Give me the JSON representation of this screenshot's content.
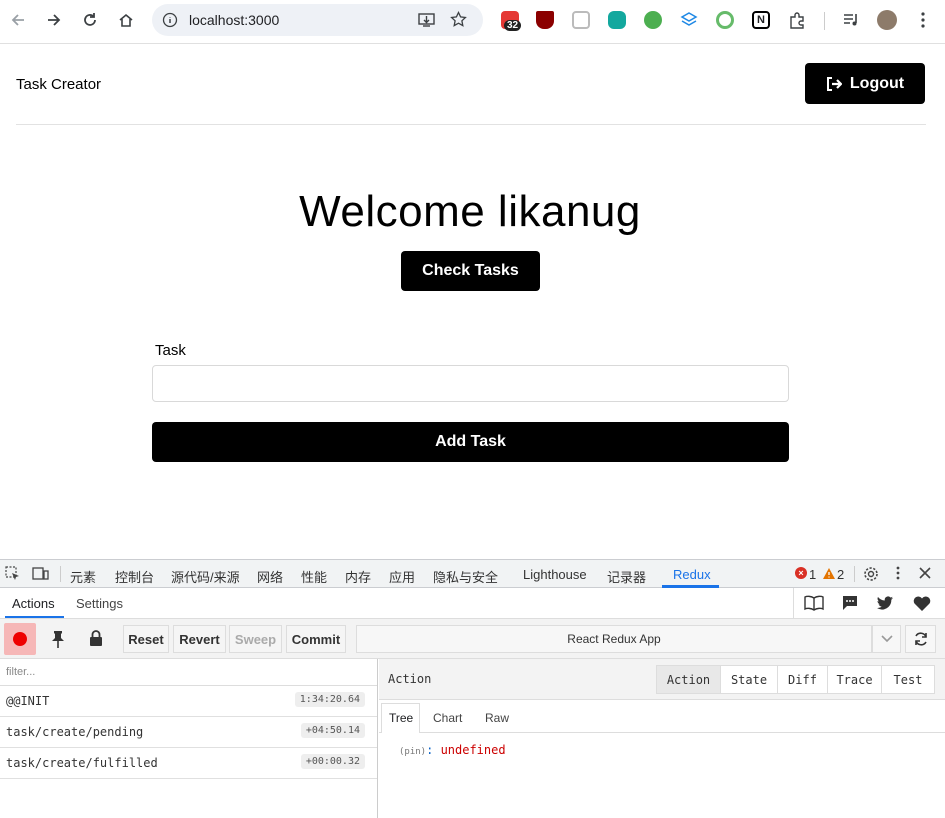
{
  "browser": {
    "url": "localhost:3000",
    "ext_badge": "32"
  },
  "app": {
    "brand": "Task Creator",
    "logout_label": "Logout",
    "welcome": "Welcome likanug",
    "check_label": "Check Tasks",
    "task_label": "Task",
    "task_value": "",
    "add_label": "Add Task"
  },
  "devtools": {
    "tabs": [
      "元素",
      "控制台",
      "源代码/来源",
      "网络",
      "性能",
      "内存",
      "应用",
      "隐私与安全",
      "Lighthouse",
      "记录器",
      "Redux"
    ],
    "errors": "1",
    "warnings": "2",
    "subtabs": {
      "actions": "Actions",
      "settings": "Settings"
    },
    "toolbar": {
      "reset": "Reset",
      "revert": "Revert",
      "sweep": "Sweep",
      "commit": "Commit",
      "instance": "React Redux App"
    },
    "filter_placeholder": "filter...",
    "actions": [
      {
        "name": "@@INIT",
        "time": "1:34:20.64"
      },
      {
        "name": "task/create/pending",
        "time": "+04:50.14"
      },
      {
        "name": "task/create/fulfilled",
        "time": "+00:00.32"
      }
    ],
    "panel": {
      "title": "Action",
      "buttons": [
        "Action",
        "State",
        "Diff",
        "Trace",
        "Test"
      ],
      "view_tabs": [
        "Tree",
        "Chart",
        "Raw"
      ],
      "pin_key": "(pin)",
      "pin_sep": ":",
      "pin_value": "undefined"
    }
  }
}
